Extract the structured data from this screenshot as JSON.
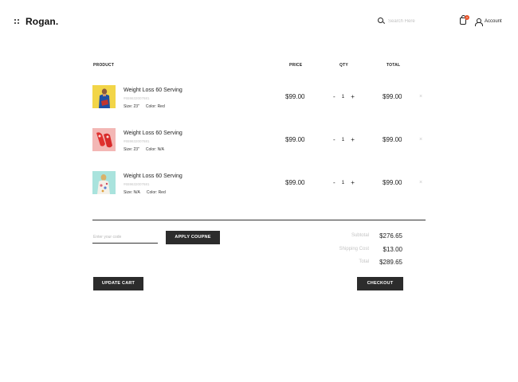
{
  "header": {
    "logo": "Rogan.",
    "search_placeholder": "Search Here",
    "cart_count": "0",
    "account_label": "Account"
  },
  "table": {
    "headers": {
      "product": "PRODUCT",
      "price": "PRICE",
      "qty": "QTY",
      "total": "TOTAL"
    },
    "rows": [
      {
        "name": "Weight Loss 60 Serving",
        "sku": "#659632007681",
        "size": "Size: 23\"",
        "color": "Color: Red",
        "price": "$99.00",
        "qty": "1",
        "total": "$99.00",
        "thumb": "model-blue-top"
      },
      {
        "name": "Weight Loss 60 Serving",
        "sku": "#659632007681",
        "size": "Size: 23\"",
        "color": "Color: N/A",
        "price": "$99.00",
        "qty": "1",
        "total": "$99.00",
        "thumb": "red-sandals"
      },
      {
        "name": "Weight Loss 60 Serving",
        "sku": "#659632007681",
        "size": "Size: N/A",
        "color": "Color: Red",
        "price": "$99.00",
        "qty": "1",
        "total": "$99.00",
        "thumb": "model-floral-dress"
      }
    ],
    "minus": "-",
    "plus": "+",
    "remove": "×"
  },
  "coupon": {
    "placeholder": "Enter your code",
    "apply_label": "APPLY COUPNE"
  },
  "summary": {
    "subtotal_label": "Subtotal",
    "subtotal_value": "$276.65",
    "shipping_label": "Shipping Cost",
    "shipping_value": "$13.00",
    "total_label": "Total",
    "total_value": "$289.65"
  },
  "actions": {
    "update_label": "UPDATE CART",
    "checkout_label": "CHECKOUT"
  },
  "colors": {
    "accent": "#e8542b",
    "button_bg": "#2c2c2c",
    "thumb_yellow": "#f2d548",
    "thumb_pink": "#f3b7b5",
    "thumb_mint": "#a9e3dd"
  }
}
